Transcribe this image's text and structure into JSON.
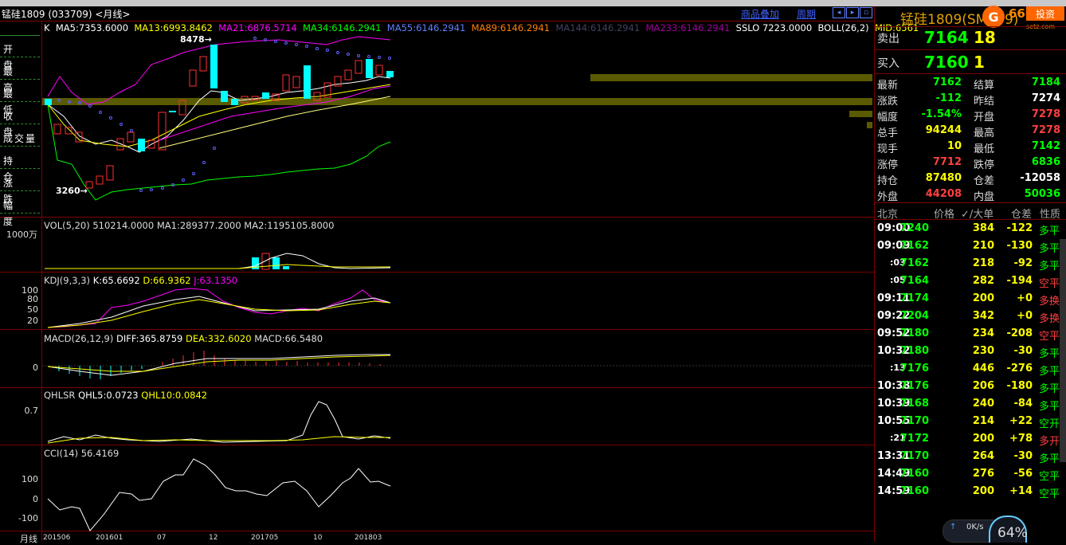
{
  "window": {
    "title": "锰硅1809 (033709) <月线>"
  },
  "toolbar": {
    "overlay_label": "商品叠加",
    "period_label": "周期"
  },
  "side_panel": {
    "items": [
      "开 盘",
      "最 高",
      "最 低",
      "收 盘",
      "成交量",
      "持 仓",
      "涨 跌",
      "幅 度"
    ]
  },
  "main_chart": {
    "legend": [
      {
        "text": "K",
        "color": "#ffffff"
      },
      {
        "text": "MA5:7353.6000",
        "color": "#ffffff"
      },
      {
        "text": "MA13:6993.8462",
        "color": "#ffff00"
      },
      {
        "text": "MA21:6876.5714",
        "color": "#ff00ff"
      },
      {
        "text": "MA34:6146.2941",
        "color": "#00ff00"
      },
      {
        "text": "MA55:6146.2941",
        "color": "#6080ff"
      },
      {
        "text": "MA89:6146.2941",
        "color": "#ff8000"
      },
      {
        "text": "MA144:6146.2941",
        "color": "#404060"
      },
      {
        "text": "MA233:6146.2941",
        "color": "#a000a0"
      },
      {
        "text": "SSLO",
        "color": "#ffffff"
      },
      {
        "text": "7223.0000",
        "color": "#ffffff"
      },
      {
        "text": "BOLL(26,2)",
        "color": "#ffffff"
      },
      {
        "text": "MID:6561",
        "color": "#ffff00"
      }
    ],
    "high_label": "8478",
    "low_label": "3260"
  },
  "vol_panel": {
    "legend": "VOL(5,20) 510214.0000 MA1:289377.2000 MA2:1195105.8000",
    "unit_label": "1000万"
  },
  "kdj_panel": {
    "legend_name": "KDJ(9,3,3)",
    "k": "K:65.6692",
    "d": "D:66.9362",
    "j": "J:63.1350",
    "ticks": [
      "100",
      "80",
      "50",
      "20"
    ]
  },
  "macd_panel": {
    "legend_name": "MACD(26,12,9)",
    "diff": "DIFF:365.8759",
    "dea": "DEA:332.6020",
    "macd": "MACD:66.5480",
    "ticks": [
      "0"
    ]
  },
  "qhlsr_panel": {
    "legend_name": "QHLSR",
    "qhl5": "QHL5:0.0723",
    "qhl10": "QHL10:0.0842",
    "ticks": [
      "0.7"
    ]
  },
  "cci_panel": {
    "legend": "CCI(14) 56.4169",
    "ticks": [
      "100",
      "0",
      "-100"
    ]
  },
  "x_axis": {
    "unit_label": "月线",
    "ticks": [
      "201506",
      "201601",
      "07",
      "12",
      "201705",
      "10",
      "201803"
    ]
  },
  "right_panel": {
    "title": "锰硅1809(SM809)",
    "sell": {
      "label": "卖出",
      "price": "7164",
      "vol": "18"
    },
    "buy": {
      "label": "买入",
      "price": "7160",
      "vol": "1"
    },
    "quotes": [
      {
        "l1": "最新",
        "v1": "7162",
        "c1": "#00ff00",
        "l2": "结算",
        "v2": "7184",
        "c2": "#00ff00"
      },
      {
        "l1": "涨跌",
        "v1": "-112",
        "c1": "#00ff00",
        "l2": "昨结",
        "v2": "7274",
        "c2": "#ffffff"
      },
      {
        "l1": "幅度",
        "v1": "-1.54%",
        "c1": "#00ff00",
        "l2": "开盘",
        "v2": "7278",
        "c2": "#ff4040"
      },
      {
        "l1": "总手",
        "v1": "94244",
        "c1": "#ffff00",
        "l2": "最高",
        "v2": "7278",
        "c2": "#ff4040"
      },
      {
        "l1": "现手",
        "v1": "10",
        "c1": "#ffff00",
        "l2": "最低",
        "v2": "7142",
        "c2": "#00ff00"
      },
      {
        "l1": "涨停",
        "v1": "7712",
        "c1": "#ff4040",
        "l2": "跌停",
        "v2": "6836",
        "c2": "#00ff00"
      },
      {
        "l1": "持仓",
        "v1": "87480",
        "c1": "#ffff00",
        "l2": "仓差",
        "v2": "-12058",
        "c2": "#ffffff"
      },
      {
        "l1": "外盘",
        "v1": "44208",
        "c1": "#ff4040",
        "l2": "内盘",
        "v2": "50036",
        "c2": "#00ff00"
      }
    ],
    "trade_header": [
      "北京",
      "价格",
      "✓/大单",
      "仓差",
      "性质"
    ],
    "trades": [
      {
        "t": "09:00",
        "p": "7240",
        "v": "384",
        "d": "-122",
        "n": "多平",
        "nc": "#00ff00"
      },
      {
        "t": "09:09",
        "p": "7162",
        "v": "210",
        "d": "-130",
        "n": "多平",
        "nc": "#00ff00"
      },
      {
        "t": ":03",
        "p": "7162",
        "v": "218",
        "d": "-92",
        "n": "多平",
        "nc": "#00ff00"
      },
      {
        "t": ":05",
        "p": "7164",
        "v": "282",
        "d": "-194",
        "n": "空平",
        "nc": "#ff4040"
      },
      {
        "t": "09:11",
        "p": "7174",
        "v": "200",
        "d": "+0",
        "n": "多换",
        "nc": "#ff4040"
      },
      {
        "t": "09:22",
        "p": "7204",
        "v": "342",
        "d": "+0",
        "n": "多换",
        "nc": "#ff4040"
      },
      {
        "t": "09:52",
        "p": "7180",
        "v": "234",
        "d": "-208",
        "n": "空平",
        "nc": "#ff4040"
      },
      {
        "t": "10:32",
        "p": "7180",
        "v": "230",
        "d": "-30",
        "n": "多平",
        "nc": "#00ff00"
      },
      {
        "t": ":13",
        "p": "7176",
        "v": "446",
        "d": "-276",
        "n": "多平",
        "nc": "#00ff00"
      },
      {
        "t": "10:38",
        "p": "7176",
        "v": "206",
        "d": "-180",
        "n": "多平",
        "nc": "#00ff00"
      },
      {
        "t": "10:39",
        "p": "7168",
        "v": "240",
        "d": "-84",
        "n": "多平",
        "nc": "#00ff00"
      },
      {
        "t": "10:55",
        "p": "7170",
        "v": "214",
        "d": "+22",
        "n": "空开",
        "nc": "#00ff00"
      },
      {
        "t": ":21",
        "p": "7172",
        "v": "200",
        "d": "+78",
        "n": "多开",
        "nc": "#ff4040"
      },
      {
        "t": "13:31",
        "p": "7170",
        "v": "264",
        "d": "-30",
        "n": "多平",
        "nc": "#00ff00"
      },
      {
        "t": "14:49",
        "p": "7160",
        "v": "276",
        "d": "-56",
        "n": "空平",
        "nc": "#00ff00"
      },
      {
        "t": "14:59",
        "p": "7160",
        "v": "200",
        "d": "+14",
        "n": "空平",
        "nc": "#00ff00"
      }
    ],
    "speed_text": "0K/s",
    "percent_text": "64%"
  }
}
